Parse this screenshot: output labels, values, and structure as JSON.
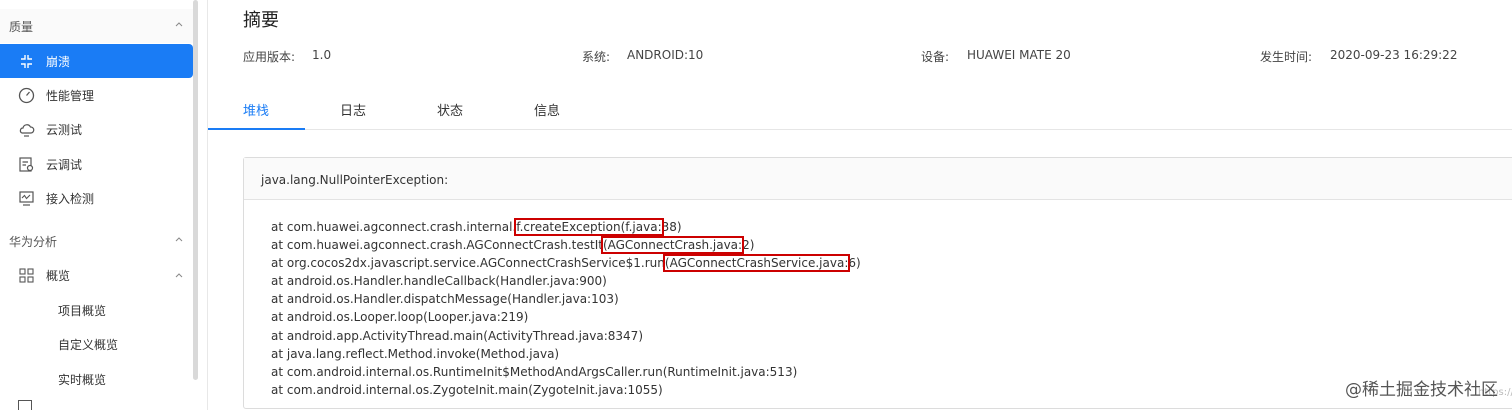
{
  "sidebar": {
    "groups": [
      {
        "label": "质量"
      },
      {
        "label": "华为分析"
      }
    ],
    "items": [
      {
        "label": "崩溃",
        "icon": "crash-icon"
      },
      {
        "label": "性能管理",
        "icon": "speedometer-icon"
      },
      {
        "label": "云测试",
        "icon": "cloud-icon"
      },
      {
        "label": "云调试",
        "icon": "debug-icon"
      },
      {
        "label": "接入检测",
        "icon": "monitor-icon"
      }
    ],
    "overview": {
      "label": "概览",
      "icon": "grid-icon"
    },
    "sub_items": [
      {
        "label": "项目概览"
      },
      {
        "label": "自定义概览"
      },
      {
        "label": "实时概览"
      }
    ]
  },
  "main": {
    "title": "摘要",
    "meta": {
      "version_label": "应用版本:",
      "version_value": "1.0",
      "system_label": "系统:",
      "system_value": "ANDROID:10",
      "device_label": "设备:",
      "device_value": "HUAWEI MATE 20",
      "time_label": "发生时间:",
      "time_value": "2020-09-23 16:29:22"
    },
    "tabs": [
      {
        "label": "堆栈",
        "active": true
      },
      {
        "label": "日志"
      },
      {
        "label": "状态"
      },
      {
        "label": "信息"
      }
    ],
    "exception": "java.lang.NullPointerException:",
    "stack": [
      {
        "pre": "at com.huawei.agconnect.crash.internal.",
        "hl": "f.createException(f.java:",
        "post": "38)"
      },
      {
        "pre": "at com.huawei.agconnect.crash.AGConnectCrash.testIt",
        "hl": "(AGConnectCrash.java:",
        "post": "2)"
      },
      {
        "pre": "at org.cocos2dx.javascript.service.AGConnectCrashService$1.run",
        "hl": "(AGConnectCrashService.java:",
        "post": "6)"
      },
      {
        "pre": "at android.os.Handler.handleCallback(Handler.java:900)"
      },
      {
        "pre": "at android.os.Handler.dispatchMessage(Handler.java:103)"
      },
      {
        "pre": "at android.os.Looper.loop(Looper.java:219)"
      },
      {
        "pre": "at android.app.ActivityThread.main(ActivityThread.java:8347)"
      },
      {
        "pre": "at java.lang.reflect.Method.invoke(Method.java)"
      },
      {
        "pre": "at com.android.internal.os.RuntimeInit$MethodAndArgsCaller.run(RuntimeInit.java:513)"
      },
      {
        "pre": "at com.android.internal.os.ZygoteInit.main(ZygoteInit.java:1055)"
      }
    ]
  },
  "watermark": "@稀土掘金技术社区",
  "watermark_faint": "https://blog"
}
